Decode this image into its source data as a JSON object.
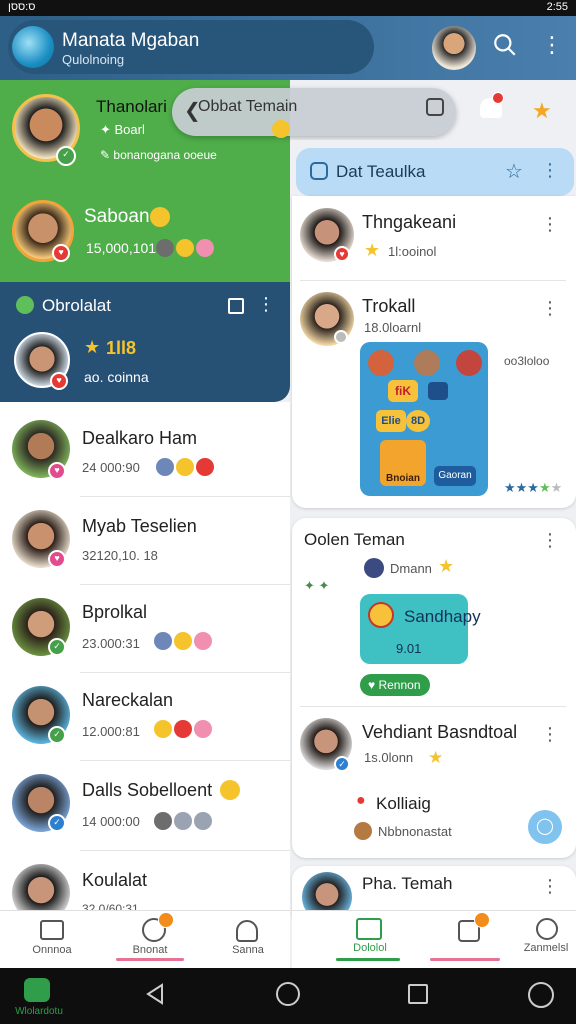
{
  "status": {
    "left": "ס:ססן",
    "right": "2:55"
  },
  "header": {
    "title": "Manata Mgaban",
    "subtitle": "Qulolnoing"
  },
  "search_pill": {
    "label": "Obbat Temain"
  },
  "left_list": {
    "green": [
      {
        "name": "Thanolari",
        "sub1": "Boarl",
        "sub2": "bonanogana ooeue"
      },
      {
        "name": "Saboan",
        "sub1": "15,000,101"
      }
    ],
    "selected": {
      "header": "Obrolalat",
      "name": "1ll8",
      "sub": "ao. coinna"
    },
    "rows": [
      {
        "name": "Dealkaro Ham",
        "sub": "24 000:90"
      },
      {
        "name": "Myab Teselien",
        "sub": "32120,10. 18"
      },
      {
        "name": "Bprolkal",
        "sub": "23.000:31"
      },
      {
        "name": "Nareckalan",
        "sub": "12.000:81"
      },
      {
        "name": "Dalls Sobelloent",
        "sub": "14 000:00"
      },
      {
        "name": "Koulalat",
        "sub": "32,0/60:31"
      }
    ]
  },
  "right_panel": {
    "header": "Dat Teaulka",
    "items": [
      {
        "name": "Thngakeani",
        "sub": "1l:ooinol"
      },
      {
        "name": "Trokall",
        "sub": "18.0loarnl",
        "side": "oo3loloo"
      }
    ],
    "game_tiles": [
      "fiK",
      "Elie",
      "8D",
      "Bnoian",
      "Gaoran"
    ],
    "card_teman": {
      "title": "Oolen Teman",
      "sub": "Dmann",
      "tile_text": "Sandhapy",
      "tile_sub": "9.01",
      "chip": "Rennon"
    },
    "item3": {
      "name": "Vehdiant Basndtoal",
      "sub": "1s.0lonn",
      "sub2": "Kolliaig",
      "sub3": "Nbbnonastat"
    },
    "item4": {
      "name": "Pha. Temah"
    }
  },
  "bottom_nav_left": [
    "Onnnoa",
    "Bnonat",
    "Sanna"
  ],
  "bottom_nav_right": [
    "Dololol",
    "Zanmelsl"
  ],
  "system_nav": {
    "brand": "Wlolardotu"
  },
  "colors": {
    "green": "#4fae4a",
    "navy": "#275075",
    "accent_blue": "#b9dbf6"
  }
}
